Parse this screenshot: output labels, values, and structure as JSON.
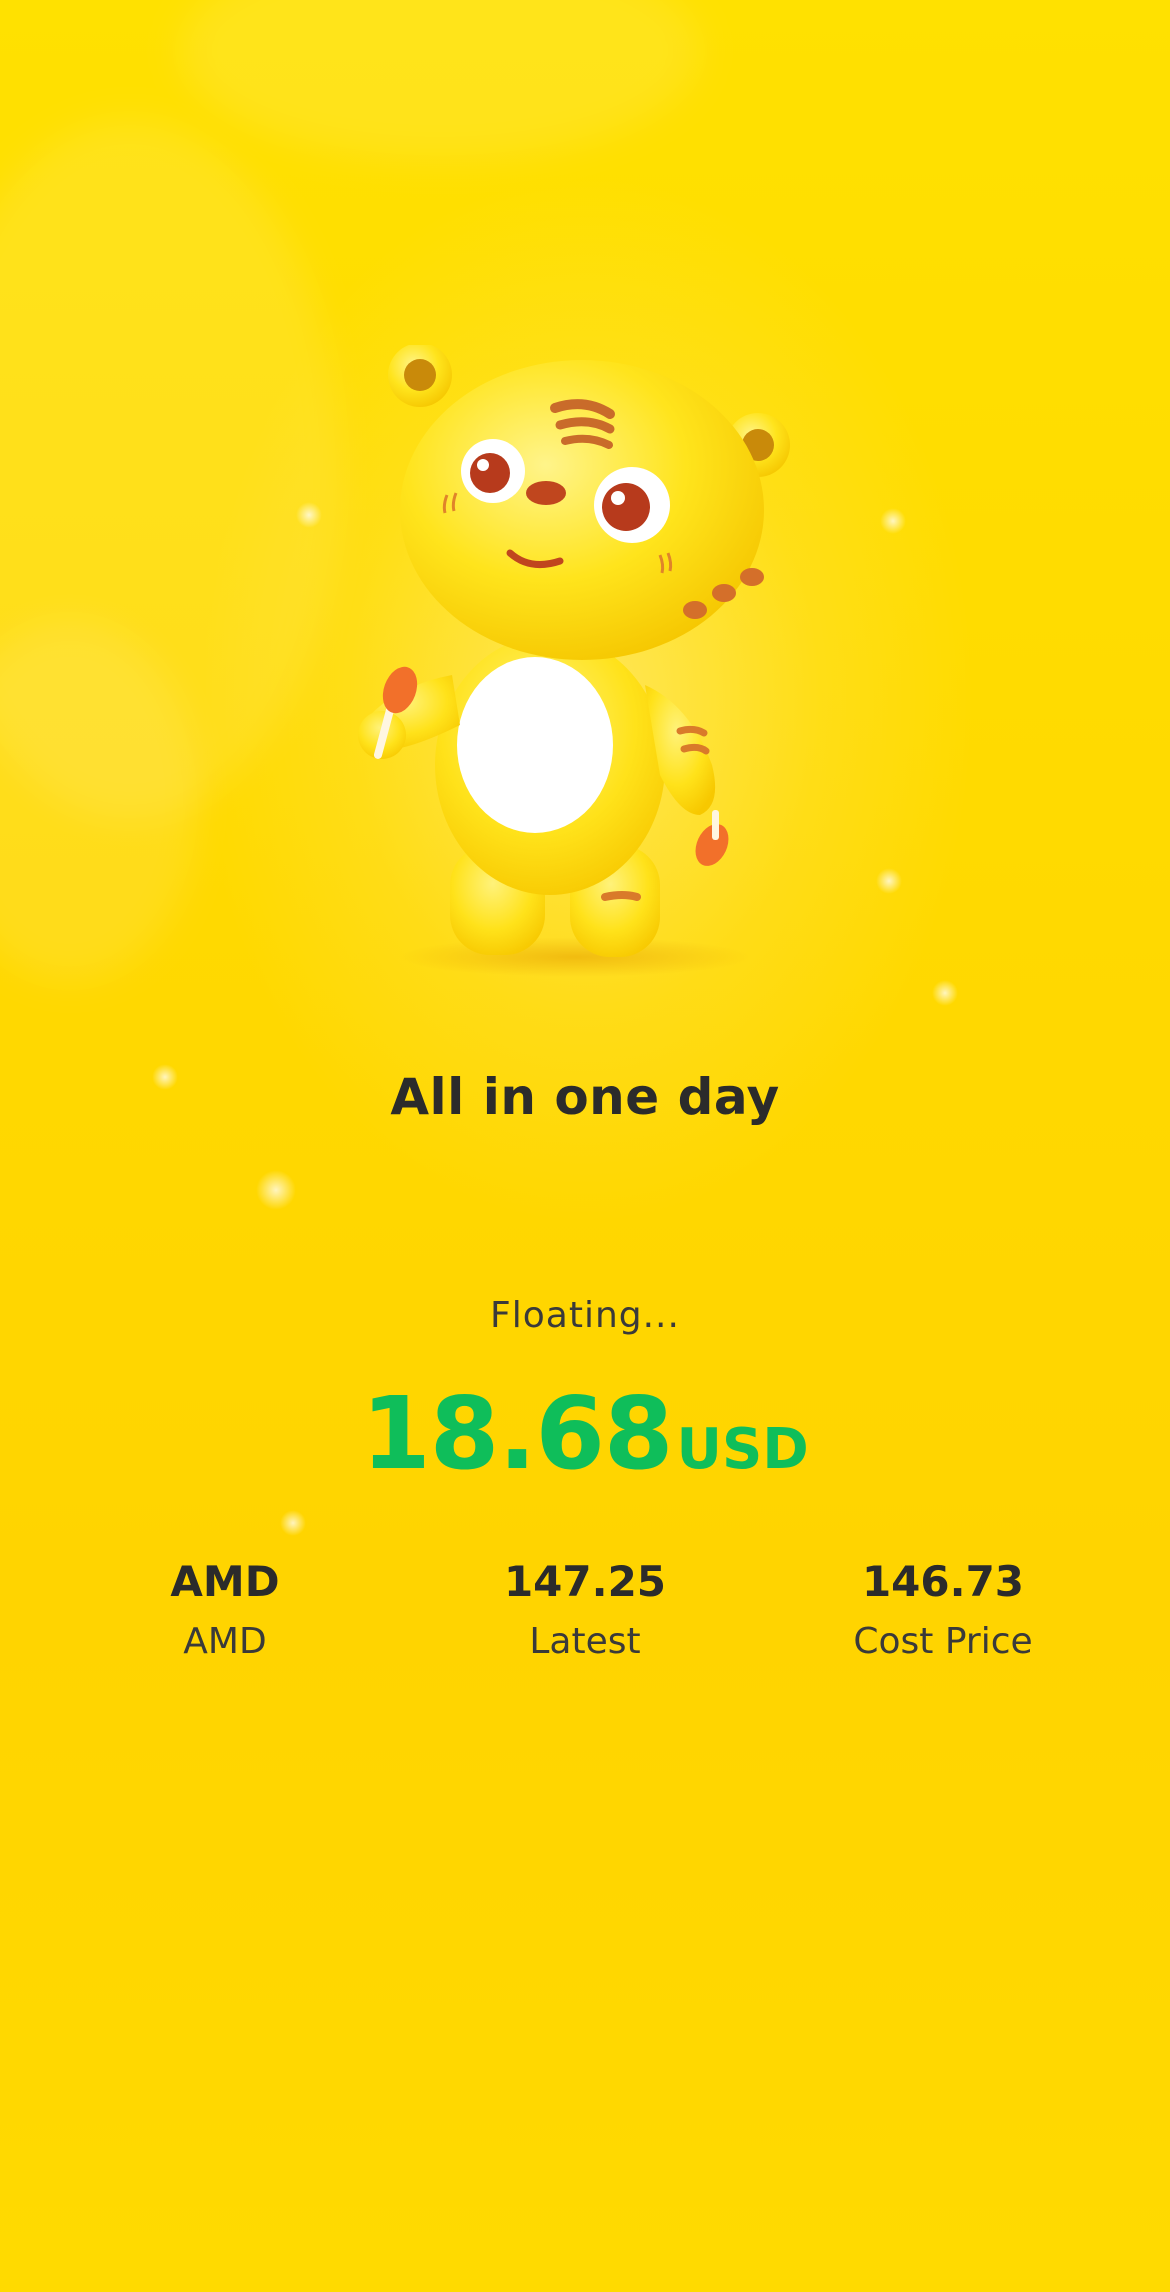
{
  "headline": "All in one day",
  "floating": {
    "label": "Floating...",
    "value": "18.68",
    "unit": "USD",
    "color": "#0fbe5a"
  },
  "stats": [
    {
      "value": "AMD",
      "label": "AMD"
    },
    {
      "value": "147.25",
      "label": "Latest"
    },
    {
      "value": "146.73",
      "label": "Cost Price"
    }
  ],
  "mascot": {
    "icon": "tiger-mascot-icon"
  },
  "colors": {
    "background": "#ffd900",
    "text": "#2b2b2b",
    "positive": "#0fbe5a"
  }
}
